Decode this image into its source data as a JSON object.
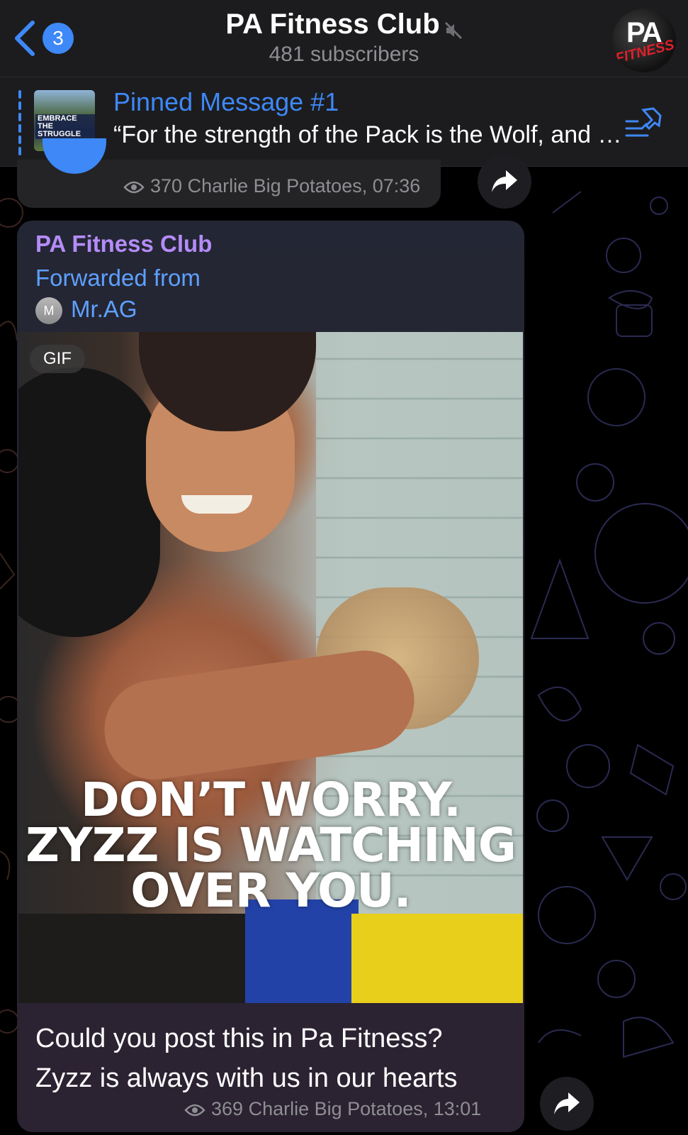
{
  "header": {
    "back_count": "3",
    "title": "PA Fitness Club",
    "subtitle": "481 subscribers",
    "avatar_text": "PA",
    "avatar_subtext": "FITNESS"
  },
  "pinned": {
    "title": "Pinned Message #1",
    "text": "“For the strength of the Pack is the Wolf, and the strength of the Wolf is the Pack”",
    "thumb_text": "EMBRACE THE STRUGGLE"
  },
  "previous_message": {
    "views": "370",
    "author_time": "Charlie Big Potatoes, 07:36"
  },
  "message": {
    "sender": "PA Fitness Club",
    "forwarded_label": "Forwarded from",
    "forwarded_initial": "M",
    "forwarded_name": "Mr.AG",
    "gif_badge": "GIF",
    "gif_caption_line1": "DON’T WORRY.",
    "gif_caption_line2": "ZYZZ IS WATCHING",
    "gif_caption_line3": "OVER YOU.",
    "text_line1": "Could you post this in Pa Fitness?",
    "text_line2": "Zyzz is always with us in our hearts",
    "views": "369",
    "author_time": "Charlie Big Potatoes, 13:01"
  },
  "colors": {
    "accent": "#3e88f7",
    "sender": "#b48cf7",
    "meta": "#8e8e93",
    "header_bg": "#1c1c1e"
  },
  "icons": [
    "chevron-left-icon",
    "mute-icon",
    "pin-list-icon",
    "eye-icon",
    "share-icon"
  ]
}
